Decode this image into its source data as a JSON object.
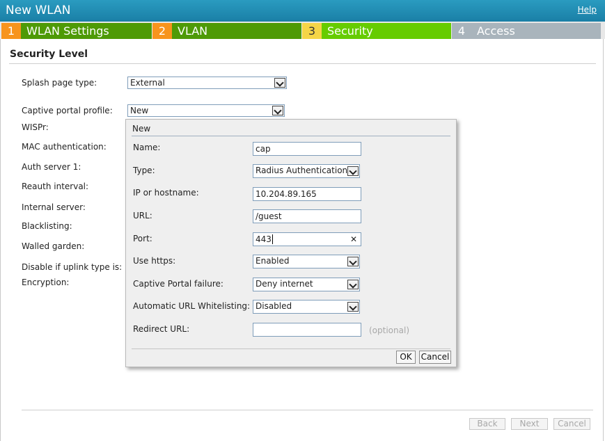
{
  "window": {
    "title": "New WLAN",
    "help": "Help"
  },
  "steps": [
    {
      "num": "1",
      "label": "WLAN Settings",
      "num_color": "#f7941d",
      "bg": "#4e9a06"
    },
    {
      "num": "2",
      "label": "VLAN",
      "num_color": "#f7941d",
      "bg": "#4e9a06"
    },
    {
      "num": "3",
      "label": "Security",
      "num_color": "#f5d547",
      "bg": "#66cc00"
    },
    {
      "num": "4",
      "label": "Access",
      "num_color": "#a9b4bc",
      "bg": "#a9b4bc"
    }
  ],
  "section_title": "Security Level",
  "form": {
    "splash_label": "Splash page type:",
    "splash_value": "External",
    "captive_label": "Captive portal profile:",
    "captive_value": "New",
    "wispr_label": "WISPr:",
    "mac_label": "MAC authentication:",
    "auth_label": "Auth server 1:",
    "reauth_label": "Reauth interval:",
    "internal_label": "Internal server:",
    "blacklisting_label": "Blacklisting:",
    "walled_label": "Walled garden:",
    "disable_label": "Disable if uplink type is:",
    "encryption_label": "Encryption:"
  },
  "dialog": {
    "title": "New",
    "name_label": "Name:",
    "name_value": "cap",
    "type_label": "Type:",
    "type_value": "Radius Authentication",
    "ip_label": "IP or hostname:",
    "ip_value": "10.204.89.165",
    "url_label": "URL:",
    "url_value": "/guest",
    "port_label": "Port:",
    "port_value": "443",
    "https_label": "Use https:",
    "https_value": "Enabled",
    "failure_label": "Captive Portal failure:",
    "failure_value": "Deny internet",
    "whitelist_label": "Automatic URL Whitelisting:",
    "whitelist_value": "Disabled",
    "redirect_label": "Redirect URL:",
    "redirect_value": "",
    "redirect_hint": "(optional)",
    "ok": "OK",
    "cancel": "Cancel"
  },
  "nav": {
    "back": "Back",
    "next": "Next",
    "cancel": "Cancel"
  },
  "colors": {
    "titlebar": "#1a8ab3",
    "disabled_text": "#a8a8a8"
  }
}
